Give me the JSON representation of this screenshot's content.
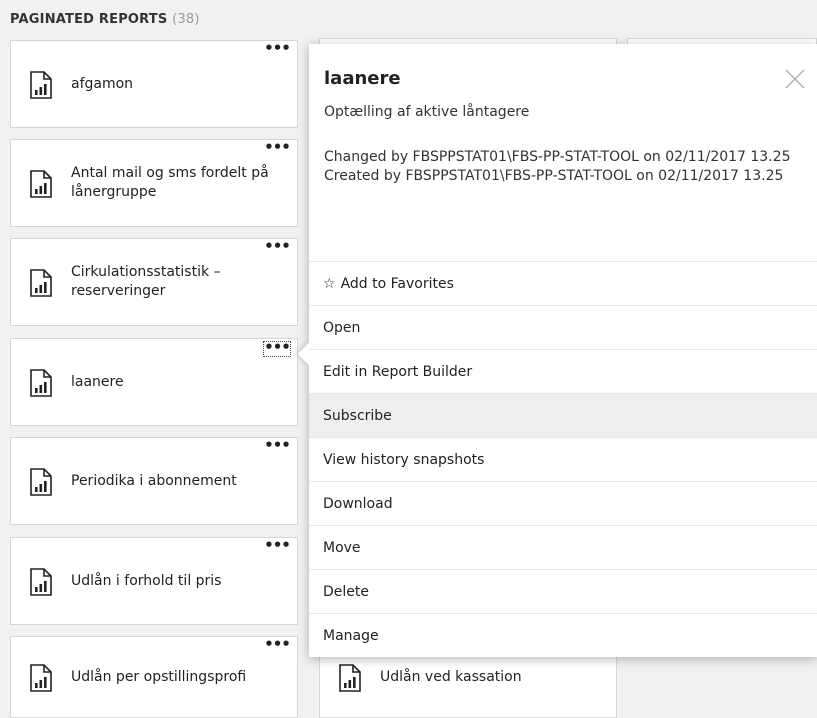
{
  "section": {
    "title": "PAGINATED REPORTS",
    "count": "(38)"
  },
  "tiles": [
    {
      "label": "afgamon"
    },
    {
      "label": "Antal mail og sms fordelt på lånergruppe"
    },
    {
      "label": "Cirkulationsstatistik – reserveringer"
    },
    {
      "label": "laanere"
    },
    {
      "label": "Periodika i abonnement"
    },
    {
      "label": "Udlån i forhold til pris"
    },
    {
      "label": "Udlån per opstillingsprofi"
    }
  ],
  "second_column_visible_tile": {
    "label": "Udlån ved kassation"
  },
  "more_button_glyph": "•••",
  "popover": {
    "title": "laanere",
    "description": "Optælling af aktive låntagere",
    "changed": "Changed by FBSPPSTAT01\\FBS-PP-STAT-TOOL on 02/11/2017 13.25",
    "created": "Created by FBSPPSTAT01\\FBS-PP-STAT-TOOL on 02/11/2017 13.25",
    "menu": [
      {
        "label": "Add to Favorites",
        "icon": "☆"
      },
      {
        "label": "Open"
      },
      {
        "label": "Edit in Report Builder"
      },
      {
        "label": "Subscribe"
      },
      {
        "label": "View history snapshots"
      },
      {
        "label": "Download"
      },
      {
        "label": "Move"
      },
      {
        "label": "Delete"
      },
      {
        "label": "Manage"
      }
    ]
  }
}
